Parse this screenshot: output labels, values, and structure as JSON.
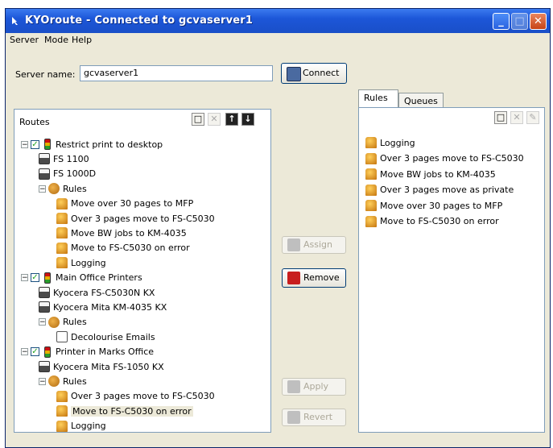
{
  "window": {
    "title": "KYOroute - Connected to gcvaserver1"
  },
  "menu": [
    "Server",
    "Mode",
    "Help"
  ],
  "server": {
    "label": "Server name:",
    "value": "gcvaserver1",
    "connect_label": "Connect"
  },
  "routes_panel": {
    "title": "Routes"
  },
  "tree": [
    {
      "level": 0,
      "expander": "−",
      "checkbox": true,
      "icon": "traffic-light-icon",
      "label": "Restrict print to desktop"
    },
    {
      "level": 1,
      "icon": "printer-icon",
      "label": "FS 1100"
    },
    {
      "level": 1,
      "icon": "printer-icon",
      "label": "FS 1000D"
    },
    {
      "level": 1,
      "expander": "−",
      "icon": "rules-icon",
      "label": "Rules"
    },
    {
      "level": 2,
      "icon": "rule-icon",
      "label": "Move over 30 pages to MFP"
    },
    {
      "level": 2,
      "icon": "rule-icon",
      "label": "Over 3 pages move to FS-C5030"
    },
    {
      "level": 2,
      "icon": "rule-icon",
      "label": "Move BW jobs to KM-4035"
    },
    {
      "level": 2,
      "icon": "rule-icon",
      "label": "Move to FS-C5030 on error"
    },
    {
      "level": 2,
      "icon": "rule-icon",
      "label": "Logging"
    },
    {
      "level": 0,
      "expander": "−",
      "checkbox": true,
      "icon": "traffic-light-icon",
      "label": "Main Office Printers"
    },
    {
      "level": 1,
      "icon": "printer-icon",
      "label": "Kyocera FS-C5030N KX"
    },
    {
      "level": 1,
      "icon": "printer-icon",
      "label": "Kyocera Mita KM-4035 KX"
    },
    {
      "level": 1,
      "expander": "−",
      "icon": "rules-icon",
      "label": "Rules"
    },
    {
      "level": 2,
      "icon": "document-icon",
      "label": "Decolourise Emails"
    },
    {
      "level": 0,
      "expander": "−",
      "checkbox": true,
      "icon": "traffic-light-icon",
      "label": "Printer in Marks Office"
    },
    {
      "level": 1,
      "icon": "printer-icon",
      "label": "Kyocera Mita FS-1050 KX"
    },
    {
      "level": 1,
      "expander": "−",
      "icon": "rules-icon",
      "label": "Rules"
    },
    {
      "level": 2,
      "icon": "rule-icon",
      "label": "Over 3 pages move to FS-C5030"
    },
    {
      "level": 2,
      "icon": "rule-icon",
      "label": "Move to FS-C5030 on error",
      "selected": true
    },
    {
      "level": 2,
      "icon": "rule-icon",
      "label": "Logging"
    }
  ],
  "middle_buttons": {
    "assign": "Assign",
    "remove": "Remove",
    "apply": "Apply",
    "revert": "Revert"
  },
  "right_tabs": [
    "Rules",
    "Queues"
  ],
  "rules_list": [
    "Logging",
    "Over 3 pages move to FS-C5030",
    "Move BW jobs to KM-4035",
    "Over 3 pages move as private",
    "Move over 30 pages to MFP",
    "Move to FS-C5030 on error"
  ]
}
